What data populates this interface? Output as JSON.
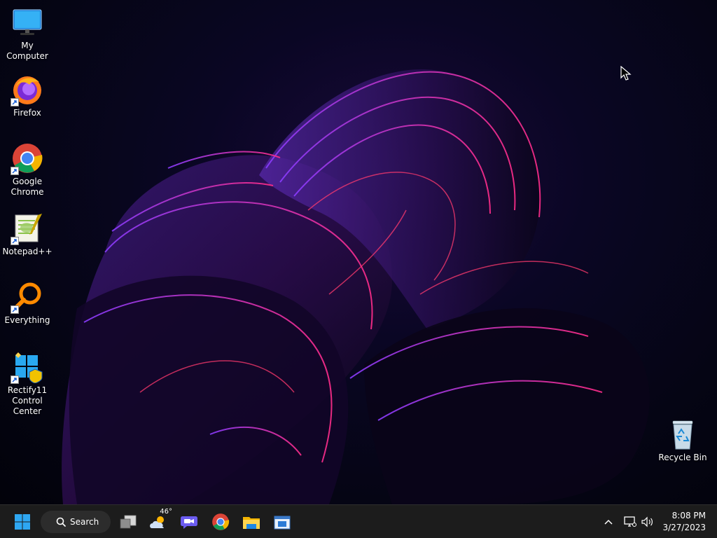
{
  "desktop": {
    "icons": [
      {
        "label": "My Computer",
        "icon": "monitor-icon"
      },
      {
        "label": "Firefox",
        "icon": "firefox-icon"
      },
      {
        "label": "Google Chrome",
        "icon": "chrome-icon"
      },
      {
        "label": "Notepad++",
        "icon": "notepadpp-icon"
      },
      {
        "label": "Everything",
        "icon": "everything-search-icon"
      },
      {
        "label": "Rectify11 Control Center",
        "icon": "rectify11-icon"
      }
    ],
    "recycle_bin": {
      "label": "Recycle Bin",
      "icon": "recycle-bin-icon"
    }
  },
  "taskbar": {
    "start_icon": "windows-start-icon",
    "search_label": "Search",
    "weather_temp": "46°",
    "apps": [
      "task-view-icon",
      "weather-icon",
      "chat-icon",
      "chrome-icon",
      "file-explorer-icon",
      "store-icon"
    ],
    "tray": {
      "overflow_icon": "chevron-up-icon",
      "network_icon": "network-icon",
      "volume_icon": "volume-icon"
    },
    "clock": {
      "time": "8:08 PM",
      "date": "3/27/2023"
    }
  },
  "colors": {
    "taskbar_bg": "#1c1c1c",
    "accent_blue": "#0078d4",
    "wallpaper_pink": "#ff2d8a",
    "wallpaper_purple": "#7a2fd8"
  }
}
